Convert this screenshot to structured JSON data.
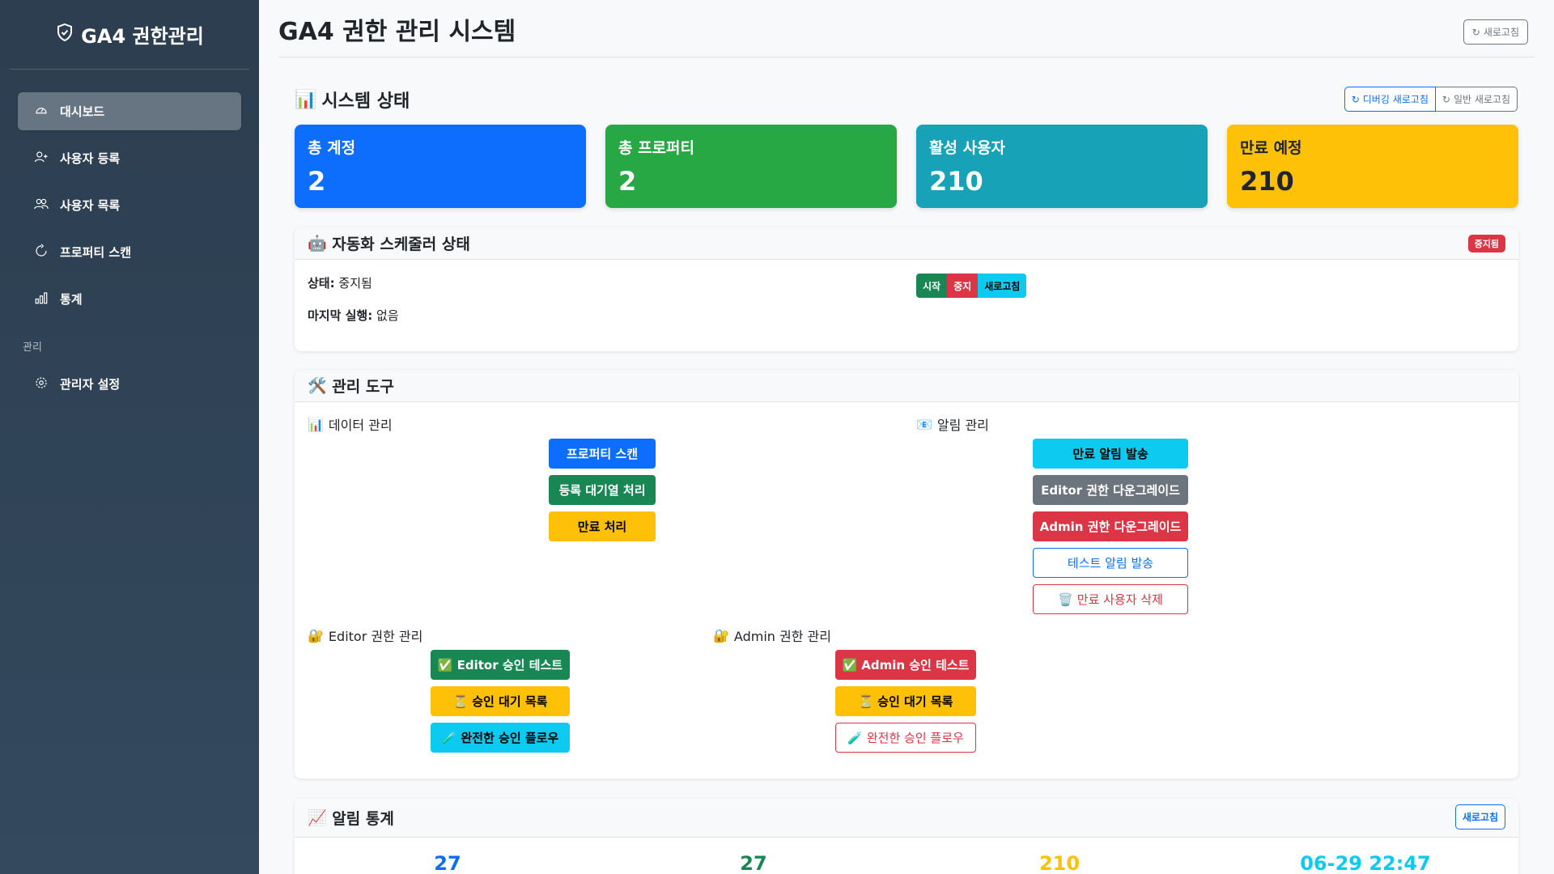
{
  "app": {
    "brand": "GA4 권한관리"
  },
  "sidebar": {
    "items": [
      {
        "label": "대시보드",
        "icon": "speedometer-icon",
        "active": true
      },
      {
        "label": "사용자 등록",
        "icon": "person-plus-icon"
      },
      {
        "label": "사용자 목록",
        "icon": "people-icon"
      },
      {
        "label": "프로퍼티 스캔",
        "icon": "refresh-icon"
      },
      {
        "label": "통계",
        "icon": "bar-chart-icon"
      }
    ],
    "section_label": "관리",
    "admin_item": {
      "label": "관리자 설정",
      "icon": "gear-icon"
    }
  },
  "header": {
    "title": "GA4 권한 관리 시스템",
    "refresh_label": "새로고침"
  },
  "system_status": {
    "title": "시스템 상태",
    "debug_refresh_label": "디버깅 새로고침",
    "normal_refresh_label": "일반 새로고침",
    "stats": [
      {
        "label": "총 계정",
        "value": "2",
        "color": "#0d6efd"
      },
      {
        "label": "총 프로퍼티",
        "value": "2",
        "color": "#28a745"
      },
      {
        "label": "활성 사용자",
        "value": "210",
        "color": "#17a2b8"
      },
      {
        "label": "만료 예정",
        "value": "210",
        "color": "#ffc107"
      }
    ]
  },
  "scheduler": {
    "title": "자동화 스케줄러 상태",
    "badge": "중지됨",
    "status_key": "상태:",
    "status_value": "중지됨",
    "last_run_key": "마지막 실행:",
    "last_run_value": "없음",
    "start_label": "시작",
    "stop_label": "중지",
    "refresh_label": "새로고침"
  },
  "admin_tools": {
    "title": "관리 도구",
    "data_mgmt": {
      "title": "데이터 관리",
      "buttons": [
        "프로퍼티 스캔",
        "등록 대기열 처리",
        "만료 처리"
      ]
    },
    "alert_mgmt": {
      "title": "알림 관리",
      "buttons": [
        "만료 알림 발송",
        "Editor 권한 다운그레이드",
        "Admin 권한 다운그레이드",
        "테스트 알림 발송",
        "만료 사용자 삭제"
      ]
    },
    "editor_mgmt": {
      "title": "Editor 권한 관리",
      "buttons": [
        "Editor 승인 테스트",
        "승인 대기 목록",
        "완전한 승인 플로우"
      ]
    },
    "admin_mgmt": {
      "title": "Admin 권한 관리",
      "buttons": [
        "Admin 승인 테스트",
        "승인 대기 목록",
        "완전한 승인 플로우"
      ]
    }
  },
  "notification_stats": {
    "title": "알림 통계",
    "refresh_label": "새로고침",
    "values": [
      {
        "value": "27",
        "color": "#0d6efd"
      },
      {
        "value": "27",
        "color": "#198754"
      },
      {
        "value": "210",
        "color": "#ffc107"
      },
      {
        "value": "06-29 22:47",
        "color": "#0dcaf0"
      }
    ]
  }
}
